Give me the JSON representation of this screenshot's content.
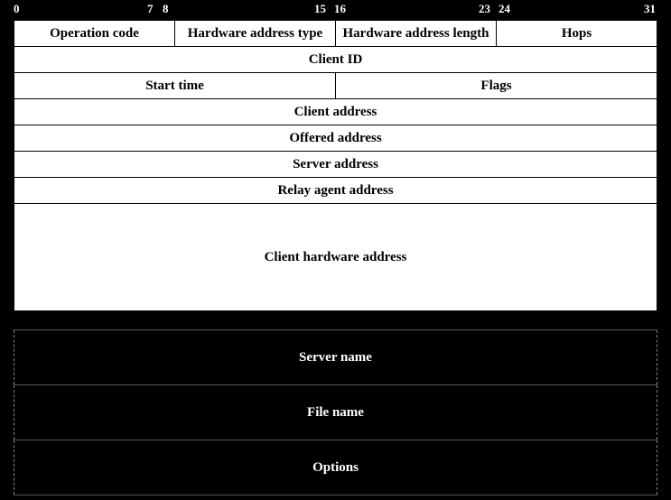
{
  "ruler": {
    "p0": "0",
    "p7": "7",
    "p8": "8",
    "p15": "15",
    "p16": "16",
    "p23": "23",
    "p24": "24",
    "p31": "31"
  },
  "fields": {
    "op": "Operation code",
    "htype": "Hardware address type",
    "hlen": "Hardware address length",
    "hops": "Hops",
    "xid": "Client ID",
    "secs": "Start time",
    "flags": "Flags",
    "ciaddr": "Client address",
    "yiaddr": "Offered address",
    "siaddr": "Server address",
    "giaddr": "Relay agent address",
    "chaddr": "Client hardware address",
    "sname": "Server name",
    "file": "File name",
    "options": "Options"
  }
}
